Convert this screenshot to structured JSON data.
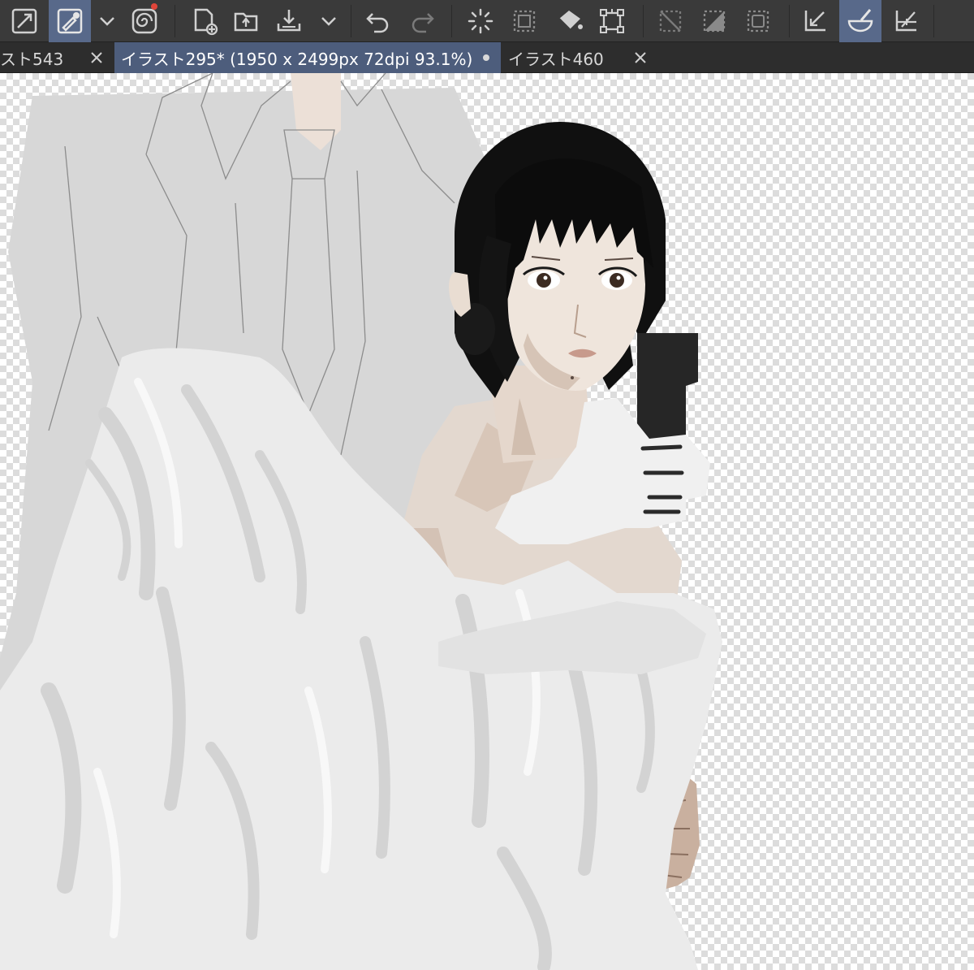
{
  "toolbar": {
    "icons": [
      "resize-icon",
      "eyedropper-pen-icon",
      "chevron-down-icon",
      "spiral-brush-icon",
      "new-canvas-icon",
      "open-folder-icon",
      "save-icon",
      "chevron-down-icon",
      "undo-icon",
      "redo-icon",
      "loading-spinner-icon",
      "selection-dotted-icon",
      "fill-bucket-icon",
      "transform-icon",
      "deselect-icon",
      "invert-selection-icon",
      "select-all-icon",
      "ruler-arrow-icon",
      "brush-bowl-icon",
      "perspective-ruler-icon"
    ],
    "active": [
      "eyedropper-pen-icon",
      "brush-bowl-icon"
    ],
    "accent_color": "#58698a"
  },
  "tabs": [
    {
      "label": "スト543",
      "state": "inactive"
    },
    {
      "label": "イラスト295* (1950 x 2499px 72dpi 93.1%)",
      "state": "active-modified"
    },
    {
      "label": "イラスト460",
      "state": "inactive"
    }
  ],
  "canvas": {
    "background": "transparent-checkerboard"
  }
}
